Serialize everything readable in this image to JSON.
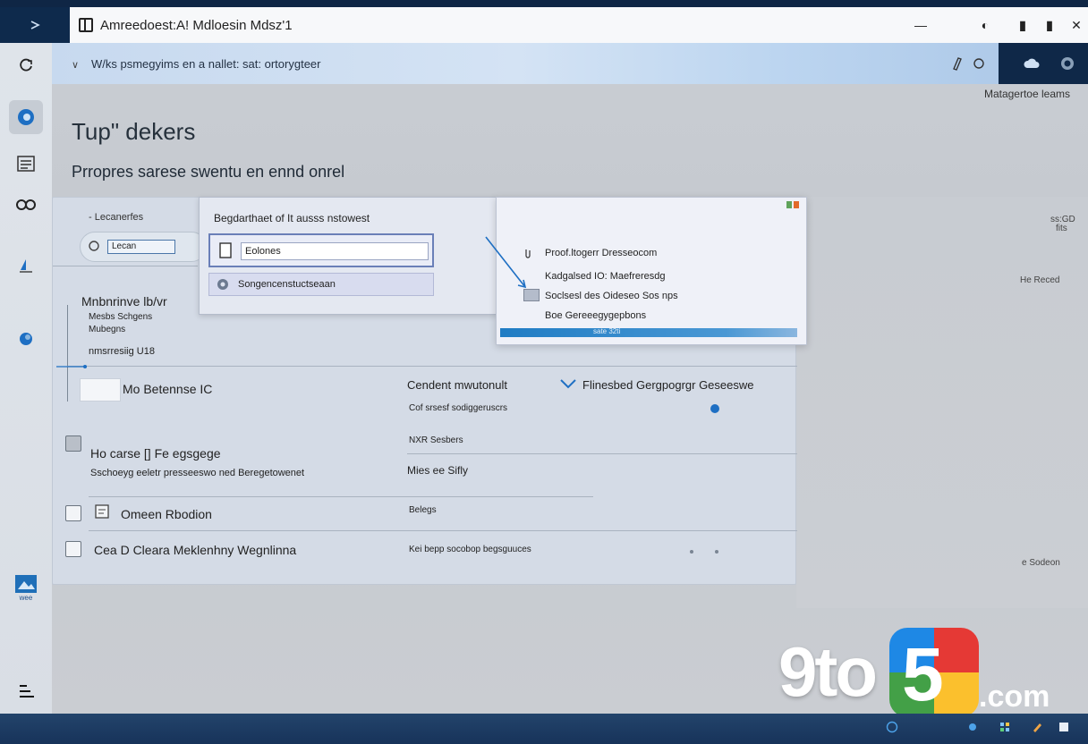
{
  "window": {
    "title": "Amreedoest:A! Mdloesin Mdsz'1",
    "minimize": "—",
    "maximize": "◐",
    "restore": "▮",
    "close": "✕"
  },
  "breadcrumb": {
    "text": "W/ks psmegyims en a nallet: sat: ortorygteer"
  },
  "header": {
    "manage_link": "Matagertoe leams",
    "title": "Tup\" dekers",
    "subtitle": "Prropres sarese swentu en ennd onrel"
  },
  "panel": {
    "top_left_label": "- Lecanerfes",
    "oval_input_value": "Lecan",
    "section_title": "Mnbnrinve lb/vr",
    "section_sub1": "Mesbs Schgens",
    "section_sub2": "Mubegns",
    "section_sub3": "nmsrresiig U18",
    "row1": {
      "label": "Mo Betennse IC",
      "col2": "Cendent mwutonult",
      "col2_sub": "Cof srsesf sodiggeruscrs",
      "col3": "Flinesbed Gergpogrgr Geseeswe",
      "col3_sub": "NXR Sesbers"
    },
    "row2": {
      "label": "Ho carse [] Fe egsgege",
      "sub": "Sschoeyg eeletr presseeswo ned Beregetowenet",
      "col2": "Mies ee Sifly"
    },
    "row3": {
      "label": "Omeen Rbodion",
      "col2": "Belegs"
    },
    "row4": {
      "label": "Cea D Cleara Meklenhny Wegnlinna",
      "col2": "Kei bepp socobop begsguuces"
    }
  },
  "right_notes": {
    "n1": "ss:GD",
    "n2": "fits",
    "n3": "He Reced",
    "n4": "e Sodeon"
  },
  "dialog": {
    "title": "Begdarthaet of It ausss nstowest",
    "input_value": "Eolones",
    "option": "Songencenstuctseaan"
  },
  "menu": {
    "items": [
      "Proof.ltogerr Dresseocom",
      "Kadgalsed IO: Maefreresdg",
      "Soclsesl des Oideseo Sos nps",
      "Boe Gereeegygepbons"
    ],
    "progress_text": "sate 32ti",
    "progress": 0.76
  },
  "watermark": {
    "a": "9to",
    "b": "5",
    "c": ".com"
  },
  "rail": {
    "bottom_label": "wee"
  },
  "colors": {
    "accent": "#1f7cc4",
    "titlebar_dark": "#0e2a4c"
  }
}
